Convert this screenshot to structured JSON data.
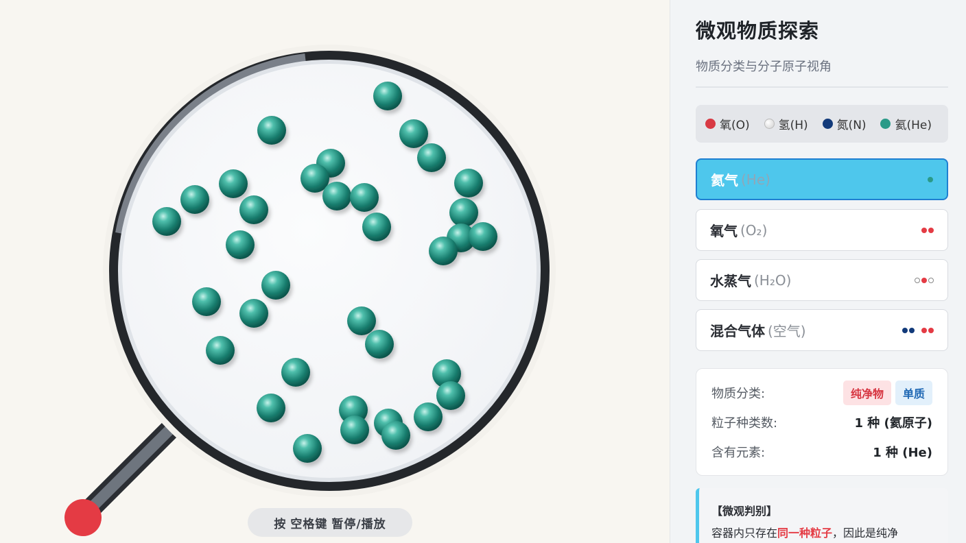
{
  "hint": {
    "prefix": "按",
    "key": "空格键",
    "suffix": "暂停/播放"
  },
  "panel": {
    "title": "微观物质探索",
    "subtitle": "物质分类与分子原子视角",
    "legend": [
      {
        "symbol": "氧(O)",
        "color": "#d83a44"
      },
      {
        "symbol": "氢(H)",
        "color": "#e8e8e8"
      },
      {
        "symbol": "氮(N)",
        "color": "#123a7a"
      },
      {
        "symbol": "氦(He)",
        "color": "#2a9a88"
      }
    ],
    "options": [
      {
        "name": "氦气",
        "formula": "(He)",
        "active": true
      },
      {
        "name": "氧气",
        "formula": "(O₂)",
        "active": false
      },
      {
        "name": "水蒸气",
        "formula": "(H₂O)",
        "active": false
      },
      {
        "name": "混合气体",
        "formula": "(空气)",
        "active": false
      }
    ],
    "info": {
      "class_label": "物质分类:",
      "tag_pure": "纯净物",
      "tag_simple": "单质",
      "kinds_label": "粒子种类数:",
      "kinds_value": "1 种 (氦原子)",
      "elements_label": "含有元素:",
      "elements_value": "1 种 (He)"
    },
    "judge": {
      "title": "【微观判别】",
      "text_before": "容器内只存在",
      "text_highlight": "同一种粒子",
      "text_after": "，因此是纯净"
    }
  },
  "colors": {
    "helium": "#2a9a88",
    "accent": "#4ec7ec",
    "handle_tip": "#e43b44"
  }
}
